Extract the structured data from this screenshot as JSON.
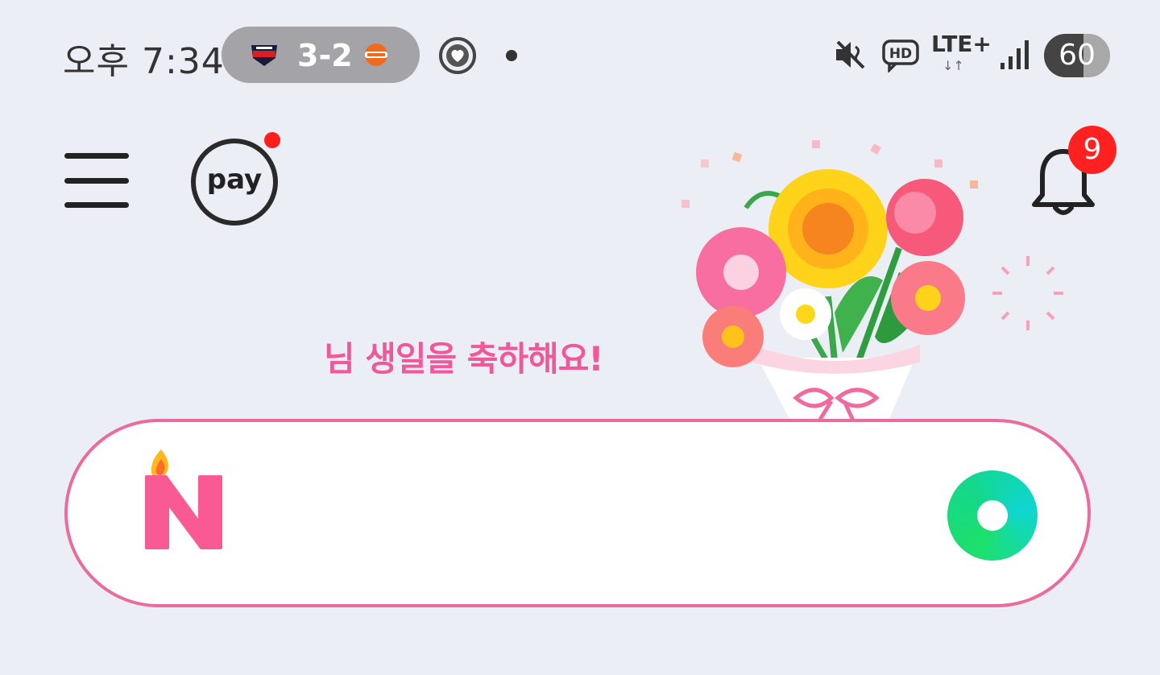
{
  "status_bar": {
    "time": "오후 7:34",
    "score": "3-2",
    "home_team_icon": "tigers-logo-icon",
    "away_team_icon": "eagles-logo-icon",
    "network_label": "LTE+",
    "network_arrows": "↓↑",
    "battery_percent": "60",
    "battery_level": 0.6
  },
  "header": {
    "menu_icon": "hamburger-menu-icon",
    "pay_label": "pay",
    "bell_icon": "bell-icon",
    "notification_count": "9"
  },
  "greeting": {
    "text": "님 생일을 축하해요!"
  },
  "search": {
    "logo_letter": "N",
    "placeholder": "",
    "value": ""
  },
  "colors": {
    "background": "#eceef5",
    "accent_pink": "#f0589a",
    "search_border": "#ea6b9d",
    "badge_red": "#ff2020",
    "green_button": "#1de06b"
  }
}
